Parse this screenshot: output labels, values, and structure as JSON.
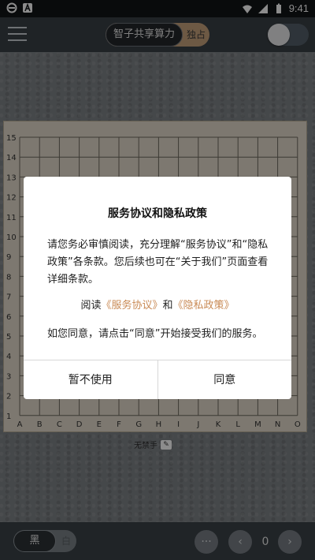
{
  "status": {
    "time": "9:41"
  },
  "topbar": {
    "mode_a": "智子共享算力",
    "mode_b": "独占"
  },
  "board": {
    "row_labels": [
      "15",
      "14",
      "13",
      "12",
      "11",
      "10",
      "9",
      "8",
      "7",
      "6",
      "5",
      "4",
      "3",
      "2",
      "1"
    ],
    "col_labels": [
      "A",
      "B",
      "C",
      "D",
      "E",
      "F",
      "G",
      "H",
      "I",
      "J",
      "K",
      "L",
      "M",
      "N",
      "O"
    ],
    "rule_text": "无禁手"
  },
  "dialog": {
    "title": "服务协议和隐私政策",
    "body": "请您务必审慎阅读，充分理解“服务协议”和“隐私政策”各条款。您后续也可在“关于我们”页面查看详细条款。",
    "read_prefix": "阅读",
    "link_service": "《服务协议》",
    "and": "和",
    "link_privacy": "《隐私政策》",
    "consent": "如您同意，请点击“同意”开始接受我们的服务。",
    "decline_label": "暂不使用",
    "agree_label": "同意"
  },
  "bottombar": {
    "black_label": "黑",
    "white_label": "白",
    "more_label": "···",
    "prev_label": "‹",
    "next_label": "›",
    "move_count": "0"
  }
}
